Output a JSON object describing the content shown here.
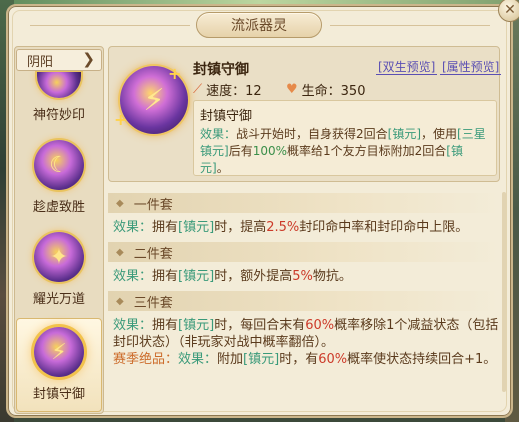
{
  "panel": {
    "title": "流派器灵",
    "close_icon": "✕"
  },
  "sidebar": {
    "filter_label": "阴阳",
    "items": [
      {
        "label": "神符妙印",
        "icon": "rune-orb-icon"
      },
      {
        "label": "趁虚致胜",
        "icon": "moon-orb-icon"
      },
      {
        "label": "耀光万道",
        "icon": "radiant-orb-icon"
      },
      {
        "label": "封镇守御",
        "icon": "seal-orb-icon",
        "active": true
      }
    ]
  },
  "detail": {
    "name": "封镇守御",
    "speed_label": "速度：12",
    "hp_label": "生命：350",
    "link_dual": "[双生预览]",
    "link_attr": "[属性预览]",
    "desc_title": "封镇守御",
    "desc_prefix": "效果：",
    "desc_1": "战斗开始时，自身获得2回合",
    "desc_tag_1": "[镇元]",
    "desc_2": "，使用",
    "desc_tag_2": "[三星镇元]",
    "desc_3": "后有",
    "desc_pct": "100%",
    "desc_4": "概率给1个友方目标附加2回合",
    "desc_tag_3": "[镇元]",
    "desc_5": "。"
  },
  "sets": {
    "one": {
      "head": "一件套",
      "prefix": "效果：",
      "a": "拥有",
      "tag": "[镇元]",
      "b": "时，提高",
      "pct": "2.5%",
      "c": "封印命中率和封印命中上限。"
    },
    "two": {
      "head": "二件套",
      "prefix": "效果：",
      "a": "拥有",
      "tag": "[镇元]",
      "b": "时，额外提高",
      "pct": "5%",
      "c": "物抗。"
    },
    "three": {
      "head": "三件套",
      "prefix": "效果：",
      "a": "拥有",
      "tag": "[镇元]",
      "b": "时，每回合末有",
      "pct": "60%",
      "c": "概率移除1个减益状态（包括封印状态）（非玩家对战中概率翻倍）。",
      "season_prefix": "赛季绝品：",
      "season_effect": "效果：",
      "s_a": "附加",
      "s_tag": "[镇元]",
      "s_b": "时，有",
      "s_pct": "60%",
      "s_c": "概率使状态持续回合+1。"
    }
  }
}
